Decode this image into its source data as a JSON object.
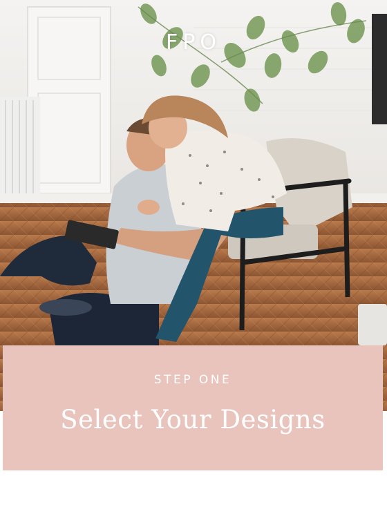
{
  "hero": {
    "watermark": "FPO",
    "image_description_icon": "photo-placeholder"
  },
  "card": {
    "eyebrow": "STEP ONE",
    "headline": "Select Your Designs"
  },
  "colors": {
    "card_background": "#e8c4bc",
    "text": "#ffffff"
  }
}
